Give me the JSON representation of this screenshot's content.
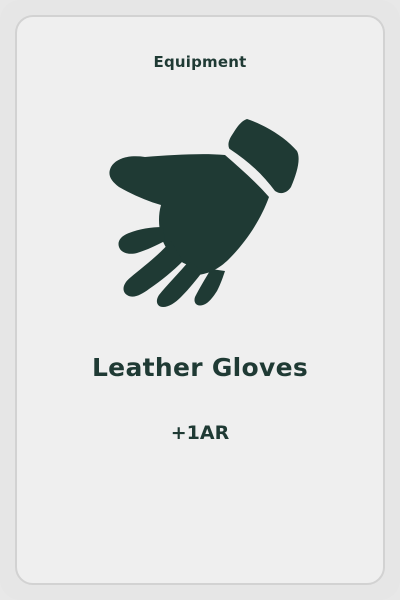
{
  "card": {
    "category": "Equipment",
    "name": "Leather Gloves",
    "stat": "+1AR",
    "icon": "glove-icon"
  },
  "colors": {
    "ink": "#1f3a34",
    "card_background": "#efefef",
    "card_border": "#d2d2d2",
    "outer_background": "#e6e6e6"
  }
}
